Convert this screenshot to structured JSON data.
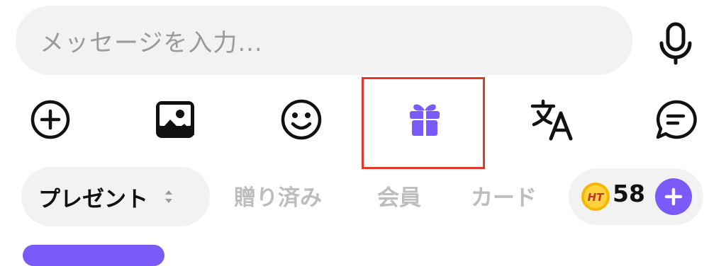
{
  "input": {
    "placeholder": "メッセージを入力..."
  },
  "toolbar": {
    "icons": [
      "plus-circle-icon",
      "image-icon",
      "smiley-icon",
      "gift-icon",
      "translate-icon",
      "chat-bubble-icon"
    ],
    "selected": "gift-icon"
  },
  "tabs": {
    "selected_label": "プレゼント",
    "others": [
      "贈り済み",
      "会員",
      "カード"
    ]
  },
  "wallet": {
    "coin_label": "HT",
    "balance": "58"
  },
  "colors": {
    "accent": "#7a5af8",
    "highlight": "#e0382c"
  }
}
